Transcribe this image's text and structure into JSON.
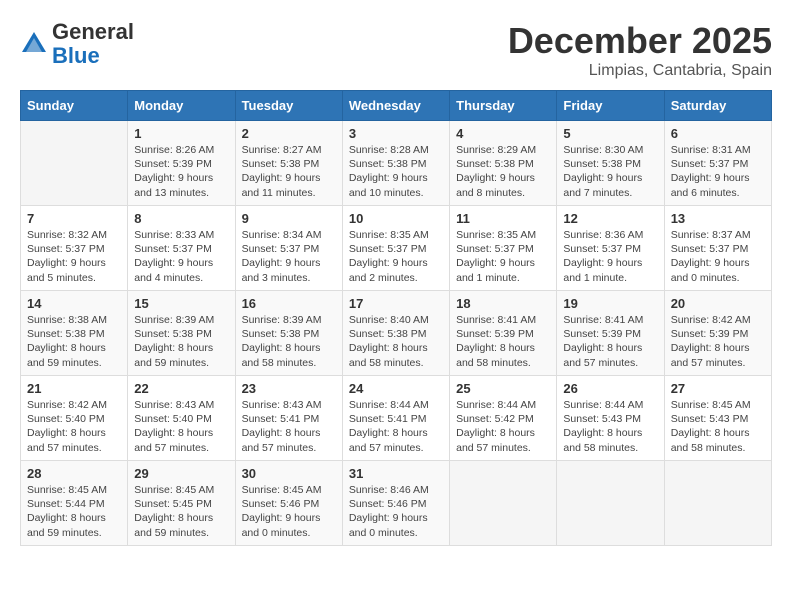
{
  "header": {
    "logo_general": "General",
    "logo_blue": "Blue",
    "month": "December 2025",
    "location": "Limpias, Cantabria, Spain"
  },
  "days_of_week": [
    "Sunday",
    "Monday",
    "Tuesday",
    "Wednesday",
    "Thursday",
    "Friday",
    "Saturday"
  ],
  "weeks": [
    [
      {
        "num": "",
        "info": ""
      },
      {
        "num": "1",
        "info": "Sunrise: 8:26 AM\nSunset: 5:39 PM\nDaylight: 9 hours\nand 13 minutes."
      },
      {
        "num": "2",
        "info": "Sunrise: 8:27 AM\nSunset: 5:38 PM\nDaylight: 9 hours\nand 11 minutes."
      },
      {
        "num": "3",
        "info": "Sunrise: 8:28 AM\nSunset: 5:38 PM\nDaylight: 9 hours\nand 10 minutes."
      },
      {
        "num": "4",
        "info": "Sunrise: 8:29 AM\nSunset: 5:38 PM\nDaylight: 9 hours\nand 8 minutes."
      },
      {
        "num": "5",
        "info": "Sunrise: 8:30 AM\nSunset: 5:38 PM\nDaylight: 9 hours\nand 7 minutes."
      },
      {
        "num": "6",
        "info": "Sunrise: 8:31 AM\nSunset: 5:37 PM\nDaylight: 9 hours\nand 6 minutes."
      }
    ],
    [
      {
        "num": "7",
        "info": "Sunrise: 8:32 AM\nSunset: 5:37 PM\nDaylight: 9 hours\nand 5 minutes."
      },
      {
        "num": "8",
        "info": "Sunrise: 8:33 AM\nSunset: 5:37 PM\nDaylight: 9 hours\nand 4 minutes."
      },
      {
        "num": "9",
        "info": "Sunrise: 8:34 AM\nSunset: 5:37 PM\nDaylight: 9 hours\nand 3 minutes."
      },
      {
        "num": "10",
        "info": "Sunrise: 8:35 AM\nSunset: 5:37 PM\nDaylight: 9 hours\nand 2 minutes."
      },
      {
        "num": "11",
        "info": "Sunrise: 8:35 AM\nSunset: 5:37 PM\nDaylight: 9 hours\nand 1 minute."
      },
      {
        "num": "12",
        "info": "Sunrise: 8:36 AM\nSunset: 5:37 PM\nDaylight: 9 hours\nand 1 minute."
      },
      {
        "num": "13",
        "info": "Sunrise: 8:37 AM\nSunset: 5:37 PM\nDaylight: 9 hours\nand 0 minutes."
      }
    ],
    [
      {
        "num": "14",
        "info": "Sunrise: 8:38 AM\nSunset: 5:38 PM\nDaylight: 8 hours\nand 59 minutes."
      },
      {
        "num": "15",
        "info": "Sunrise: 8:39 AM\nSunset: 5:38 PM\nDaylight: 8 hours\nand 59 minutes."
      },
      {
        "num": "16",
        "info": "Sunrise: 8:39 AM\nSunset: 5:38 PM\nDaylight: 8 hours\nand 58 minutes."
      },
      {
        "num": "17",
        "info": "Sunrise: 8:40 AM\nSunset: 5:38 PM\nDaylight: 8 hours\nand 58 minutes."
      },
      {
        "num": "18",
        "info": "Sunrise: 8:41 AM\nSunset: 5:39 PM\nDaylight: 8 hours\nand 58 minutes."
      },
      {
        "num": "19",
        "info": "Sunrise: 8:41 AM\nSunset: 5:39 PM\nDaylight: 8 hours\nand 57 minutes."
      },
      {
        "num": "20",
        "info": "Sunrise: 8:42 AM\nSunset: 5:39 PM\nDaylight: 8 hours\nand 57 minutes."
      }
    ],
    [
      {
        "num": "21",
        "info": "Sunrise: 8:42 AM\nSunset: 5:40 PM\nDaylight: 8 hours\nand 57 minutes."
      },
      {
        "num": "22",
        "info": "Sunrise: 8:43 AM\nSunset: 5:40 PM\nDaylight: 8 hours\nand 57 minutes."
      },
      {
        "num": "23",
        "info": "Sunrise: 8:43 AM\nSunset: 5:41 PM\nDaylight: 8 hours\nand 57 minutes."
      },
      {
        "num": "24",
        "info": "Sunrise: 8:44 AM\nSunset: 5:41 PM\nDaylight: 8 hours\nand 57 minutes."
      },
      {
        "num": "25",
        "info": "Sunrise: 8:44 AM\nSunset: 5:42 PM\nDaylight: 8 hours\nand 57 minutes."
      },
      {
        "num": "26",
        "info": "Sunrise: 8:44 AM\nSunset: 5:43 PM\nDaylight: 8 hours\nand 58 minutes."
      },
      {
        "num": "27",
        "info": "Sunrise: 8:45 AM\nSunset: 5:43 PM\nDaylight: 8 hours\nand 58 minutes."
      }
    ],
    [
      {
        "num": "28",
        "info": "Sunrise: 8:45 AM\nSunset: 5:44 PM\nDaylight: 8 hours\nand 59 minutes."
      },
      {
        "num": "29",
        "info": "Sunrise: 8:45 AM\nSunset: 5:45 PM\nDaylight: 8 hours\nand 59 minutes."
      },
      {
        "num": "30",
        "info": "Sunrise: 8:45 AM\nSunset: 5:46 PM\nDaylight: 9 hours\nand 0 minutes."
      },
      {
        "num": "31",
        "info": "Sunrise: 8:46 AM\nSunset: 5:46 PM\nDaylight: 9 hours\nand 0 minutes."
      },
      {
        "num": "",
        "info": ""
      },
      {
        "num": "",
        "info": ""
      },
      {
        "num": "",
        "info": ""
      }
    ]
  ]
}
